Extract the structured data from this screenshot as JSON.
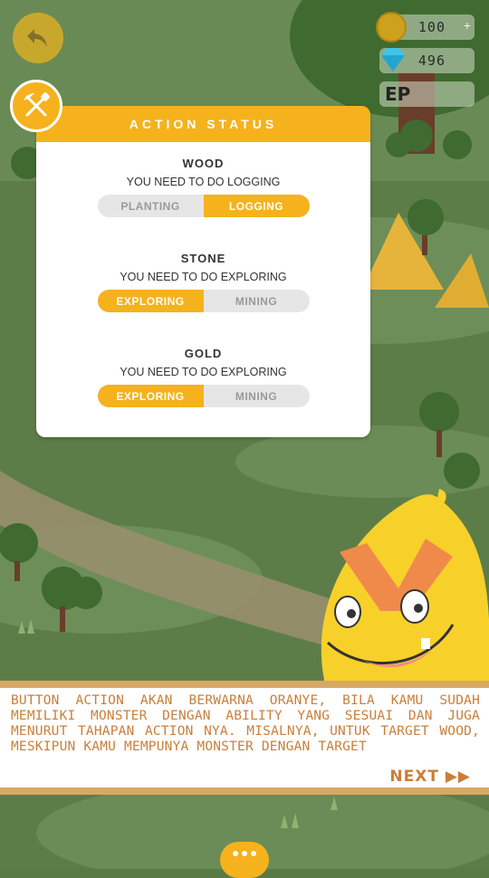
{
  "hud": {
    "coins": "100",
    "gems": "496",
    "ep_label": "EP"
  },
  "panel": {
    "title": "ACTION STATUS",
    "resources": [
      {
        "name": "WOOD",
        "hint": "YOU NEED TO DO LOGGING",
        "options": [
          "PLANTING",
          "LOGGING"
        ],
        "active": 1
      },
      {
        "name": "STONE",
        "hint": "YOU NEED TO DO EXPLORING",
        "options": [
          "EXPLORING",
          "MINING"
        ],
        "active": 0
      },
      {
        "name": "GOLD",
        "hint": "YOU NEED TO DO EXPLORING",
        "options": [
          "EXPLORING",
          "MINING"
        ],
        "active": 0
      }
    ]
  },
  "dialog": {
    "text": "BUTTON ACTION AKAN BERWARNA ORANYE, BILA KAMU SUDAH MEMILIKI MONSTER DENGAN ABILITY YANG SESUAI DAN JUGA MENURUT TAHAPAN ACTION NYA. MISALNYA, UNTUK TARGET WOOD, MESKIPUN KAMU MEMPUNYA MONSTER DENGAN TARGET",
    "next_label": "NEXT ▶▶"
  },
  "colors": {
    "accent": "#f5b21d",
    "dialog_text": "#c97f3a",
    "inactive_toggle": "#e6e6e6"
  }
}
